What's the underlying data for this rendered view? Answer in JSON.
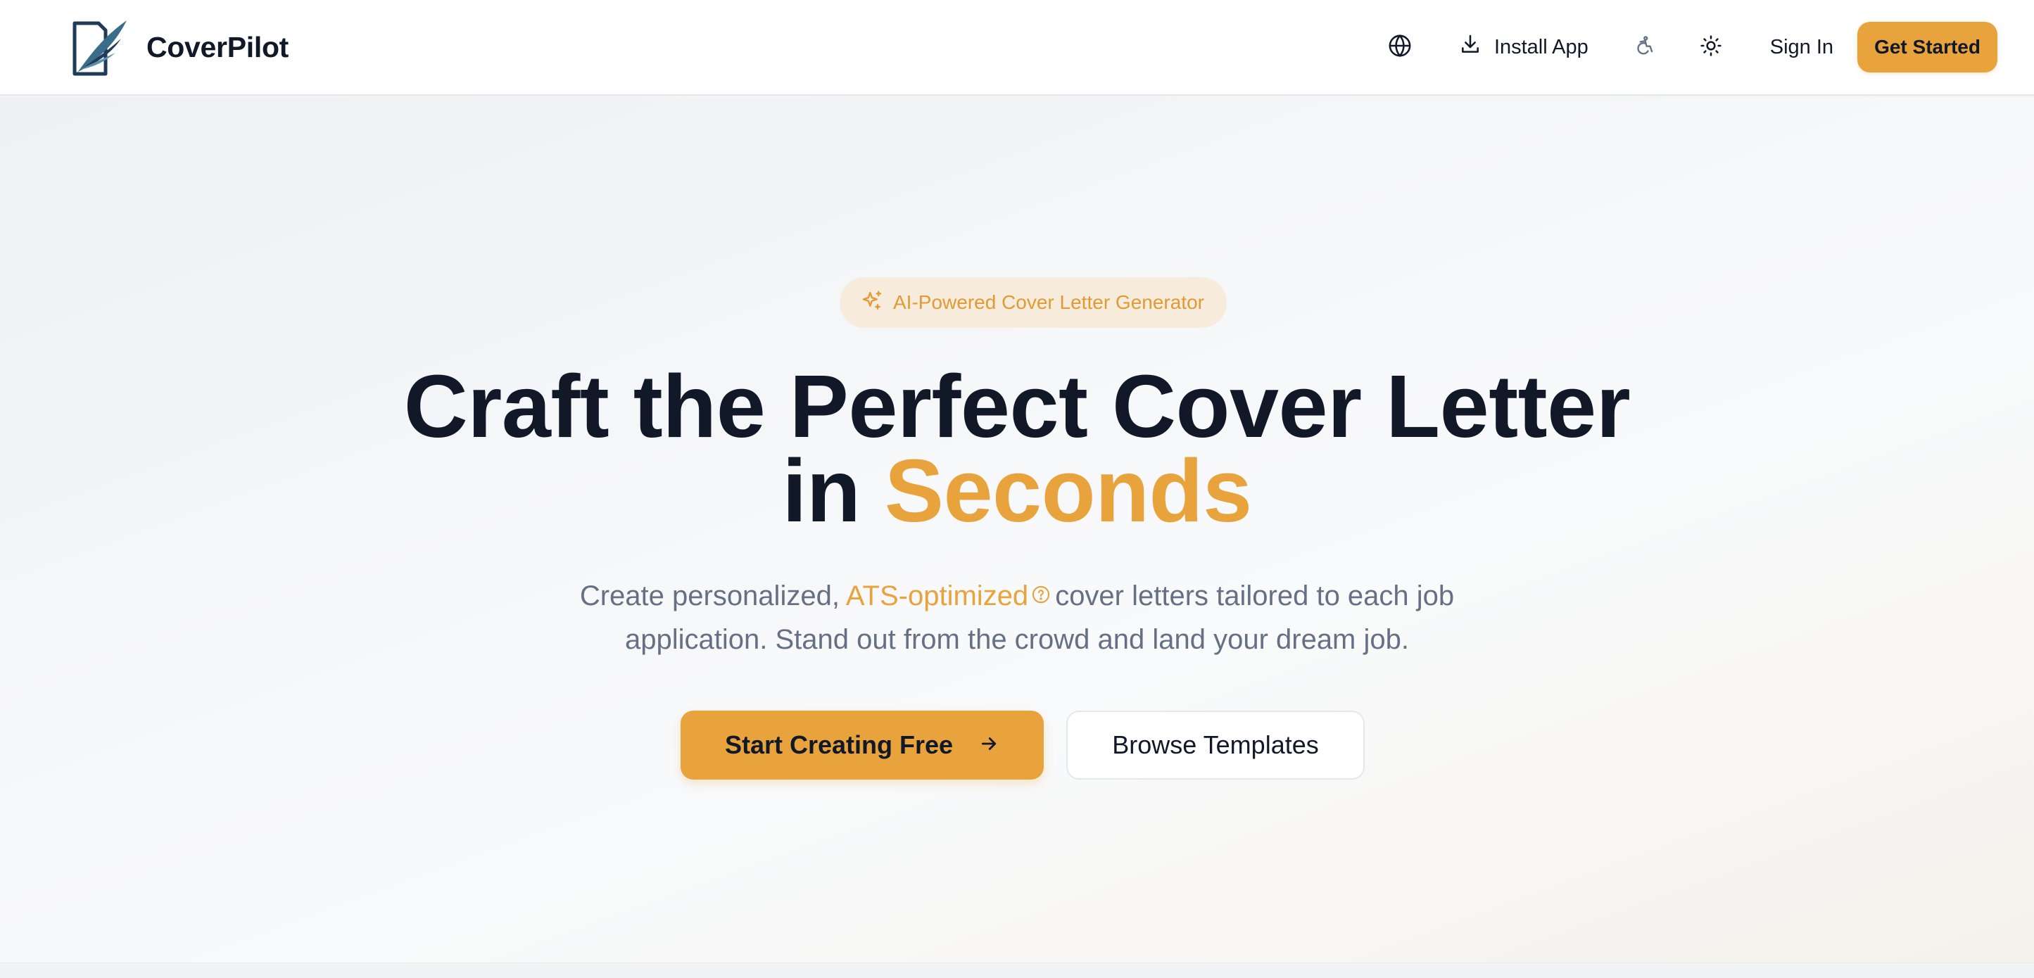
{
  "header": {
    "brand_name": "CoverPilot",
    "logo_icon": "feather-document-logo",
    "language_icon": "globe-icon",
    "install_label": "Install App",
    "install_icon": "download-icon",
    "accessibility_icon": "accessibility-icon",
    "theme_icon": "sun-icon",
    "signin_label": "Sign In",
    "get_started_label": "Get Started"
  },
  "hero": {
    "badge_icon": "sparkles-icon",
    "badge_text": "AI-Powered Cover Letter Generator",
    "headline_line1": "Craft the Perfect Cover Letter",
    "headline_in": "in",
    "headline_accent": "Seconds",
    "subtext_prefix": "Create personalized,",
    "subtext_highlight": "ATS-optimized",
    "subtext_help_icon": "help-circle-icon",
    "subtext_suffix_line1": "cover letters tailored to each job",
    "subtext_line2": "application. Stand out from the crowd and land your dream job.",
    "primary_cta_label": "Start Creating Free",
    "primary_cta_icon": "arrow-right-icon",
    "secondary_cta_label": "Browse Templates"
  },
  "colors": {
    "accent": "#e8a33d",
    "text_dark": "#111827",
    "text_muted": "#667085",
    "badge_bg": "#f7ebdc",
    "logo_navy": "#1f3b57"
  }
}
